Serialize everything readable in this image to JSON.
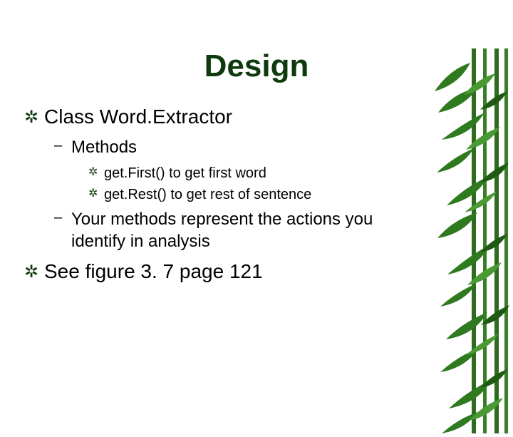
{
  "title": "Design",
  "bullets": {
    "a": "Class Word.Extractor",
    "a1": "Methods",
    "a1a": "get.First() to get first word",
    "a1b": "get.Rest() to get rest of sentence",
    "a2": "Your methods represent the actions you identify in analysis",
    "b": "See figure 3. 7 page 121"
  },
  "bullet_chars": {
    "star": "✲",
    "dash": "–"
  }
}
